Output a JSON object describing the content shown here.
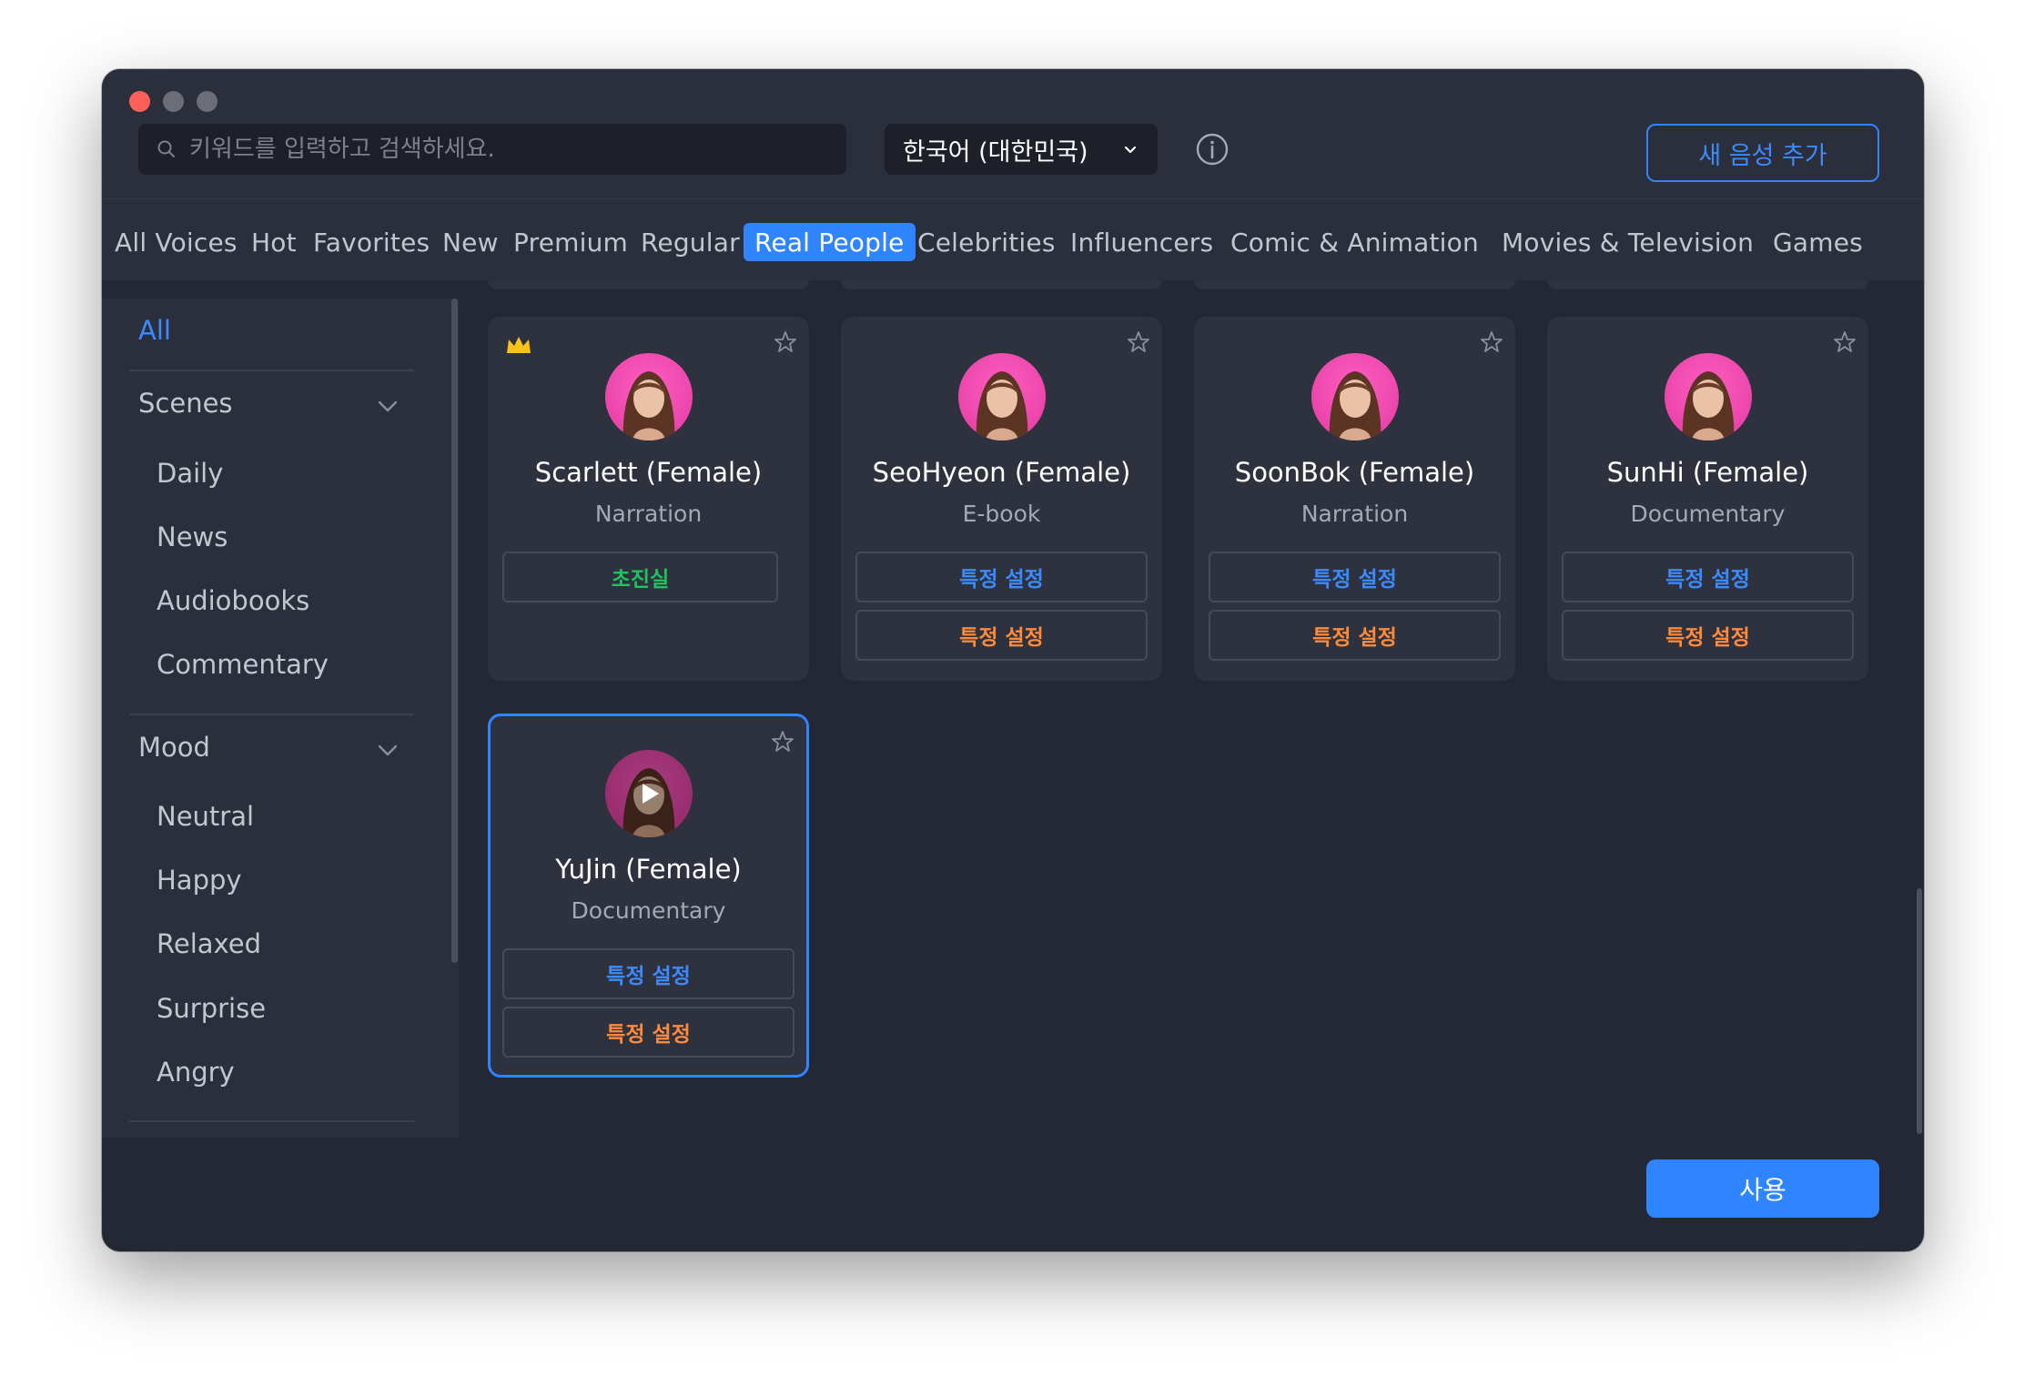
{
  "search": {
    "placeholder": "키워드를 입력하고 검색하세요."
  },
  "language": {
    "selected": "한국어 (대한민국)"
  },
  "header": {
    "add_voice_label": "새 음성 추가"
  },
  "tabs": [
    {
      "label": "All Voices"
    },
    {
      "label": "Hot"
    },
    {
      "label": "Favorites"
    },
    {
      "label": "New"
    },
    {
      "label": "Premium"
    },
    {
      "label": "Regular"
    },
    {
      "label": "Real People",
      "active": true
    },
    {
      "label": "Celebrities"
    },
    {
      "label": "Influencers"
    },
    {
      "label": "Comic & Animation"
    },
    {
      "label": "Movies & Television"
    },
    {
      "label": "Games"
    }
  ],
  "sidebar": {
    "all_label": "All",
    "groups": [
      {
        "label": "Scenes",
        "items": [
          "Daily",
          "News",
          "Audiobooks",
          "Commentary"
        ]
      },
      {
        "label": "Mood",
        "items": [
          "Neutral",
          "Happy",
          "Relaxed",
          "Surprise",
          "Angry"
        ]
      }
    ]
  },
  "voices": [
    {
      "name": "Scarlett (Female)",
      "category": "Narration",
      "premium": true,
      "buttons": [
        {
          "label": "초진실",
          "color": "#21c25e"
        }
      ]
    },
    {
      "name": "SeoHyeon (Female)",
      "category": "E-book",
      "buttons": [
        {
          "label": "특정 설정",
          "color": "#3b8bff"
        },
        {
          "label": "특정 설정",
          "color": "#ff8a3b"
        }
      ]
    },
    {
      "name": "SoonBok (Female)",
      "category": "Narration",
      "buttons": [
        {
          "label": "특정 설정",
          "color": "#3b8bff"
        },
        {
          "label": "특정 설정",
          "color": "#ff8a3b"
        }
      ]
    },
    {
      "name": "SunHi (Female)",
      "category": "Documentary",
      "buttons": [
        {
          "label": "특정 설정",
          "color": "#3b8bff"
        },
        {
          "label": "특정 설정",
          "color": "#ff8a3b"
        }
      ]
    },
    {
      "name": "YuJin (Female)",
      "category": "Documentary",
      "selected": true,
      "buttons": [
        {
          "label": "특정 설정",
          "color": "#3b8bff"
        },
        {
          "label": "특정 설정",
          "color": "#ff8a3b"
        }
      ]
    }
  ],
  "footer": {
    "use_label": "사용"
  },
  "colors": {
    "accent": "#2f84ff",
    "window_bg": "#242834",
    "panel_bg": "#2b2f3b",
    "card_bg": "#2e323e"
  }
}
